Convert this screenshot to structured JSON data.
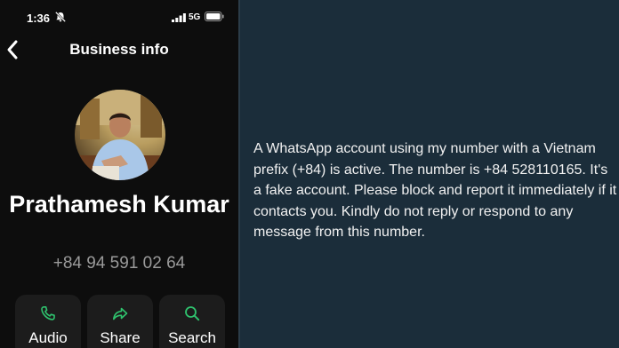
{
  "status_bar": {
    "time": "1:36",
    "network": "5G"
  },
  "header": {
    "title": "Business info"
  },
  "contact": {
    "name": "Prathamesh Kumar",
    "phone": "+84 94 591 02 64"
  },
  "actions": [
    {
      "label": "Audio",
      "icon": "phone-icon"
    },
    {
      "label": "Share",
      "icon": "share-icon"
    },
    {
      "label": "Search",
      "icon": "search-icon"
    }
  ],
  "message": {
    "text": "A WhatsApp account using my number with a Vietnam prefix (+84) is active. The number is +84 528110165. It's a fake account. Please block and report it immediately if it contacts you. Kindly do not reply or respond to any message from this number."
  },
  "colors": {
    "phone_background": "#0d0d0d",
    "panel_background": "#1b2d3a",
    "accent_green": "#2fc36e",
    "button_background": "#1c1c1c",
    "secondary_text": "#9a9a9a"
  }
}
